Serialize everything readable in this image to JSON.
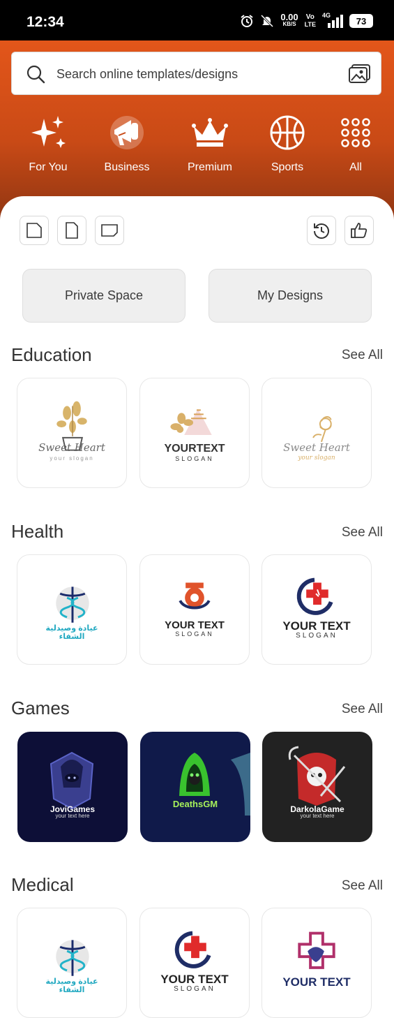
{
  "status_bar": {
    "time": "12:34",
    "net_speed_value": "0.00",
    "net_speed_unit": "KB/S",
    "volte_top": "Vo",
    "volte_bottom": "LTE",
    "network": "4G",
    "battery": "73"
  },
  "search": {
    "placeholder": "Search online templates/designs"
  },
  "categories": [
    {
      "label": "For You",
      "icon": "sparkles-icon"
    },
    {
      "label": "Business",
      "icon": "megaphone-icon"
    },
    {
      "label": "Premium",
      "icon": "crown-icon"
    },
    {
      "label": "Sports",
      "icon": "basketball-icon"
    },
    {
      "label": "All",
      "icon": "grid-dots-icon"
    }
  ],
  "size_buttons": [
    "square-size-icon",
    "portrait-size-icon",
    "landscape-size-icon"
  ],
  "action_buttons": [
    "history-icon",
    "thumbs-up-icon"
  ],
  "spaces": {
    "private": "Private Space",
    "designs": "My Designs"
  },
  "sections": [
    {
      "title": "Education",
      "see_all": "See All",
      "cards": [
        {
          "line1": "Sweet Heart",
          "line2": "your slogan"
        },
        {
          "line1": "YOURTEXT",
          "line2": "SLOGAN"
        },
        {
          "line1": "Sweet Heart",
          "line2": "your slogan"
        }
      ]
    },
    {
      "title": "Health",
      "see_all": "See All",
      "cards": [
        {
          "line1": "عيادة وصيدلية",
          "line2": "الشفاء"
        },
        {
          "line1": "YOUR TEXT",
          "line2": "SLOGAN"
        },
        {
          "line1": "YOUR TEXT",
          "line2": "SLOGAN"
        }
      ]
    },
    {
      "title": "Games",
      "see_all": "See All",
      "cards": [
        {
          "line1": "JoviGames",
          "line2": "your text here"
        },
        {
          "line1": "DeathsGM",
          "line2": ""
        },
        {
          "line1": "DarkolaGame",
          "line2": "your text here"
        }
      ]
    },
    {
      "title": "Medical",
      "see_all": "See All",
      "cards": [
        {
          "line1": "عيادة وصيدلية",
          "line2": "الشفاء"
        },
        {
          "line1": "YOUR TEXT",
          "line2": "SLOGAN"
        },
        {
          "line1": "YOUR TEXT",
          "line2": ""
        }
      ]
    }
  ],
  "colors": {
    "accent": "#e3561a",
    "accent_dark": "#8e3512"
  }
}
